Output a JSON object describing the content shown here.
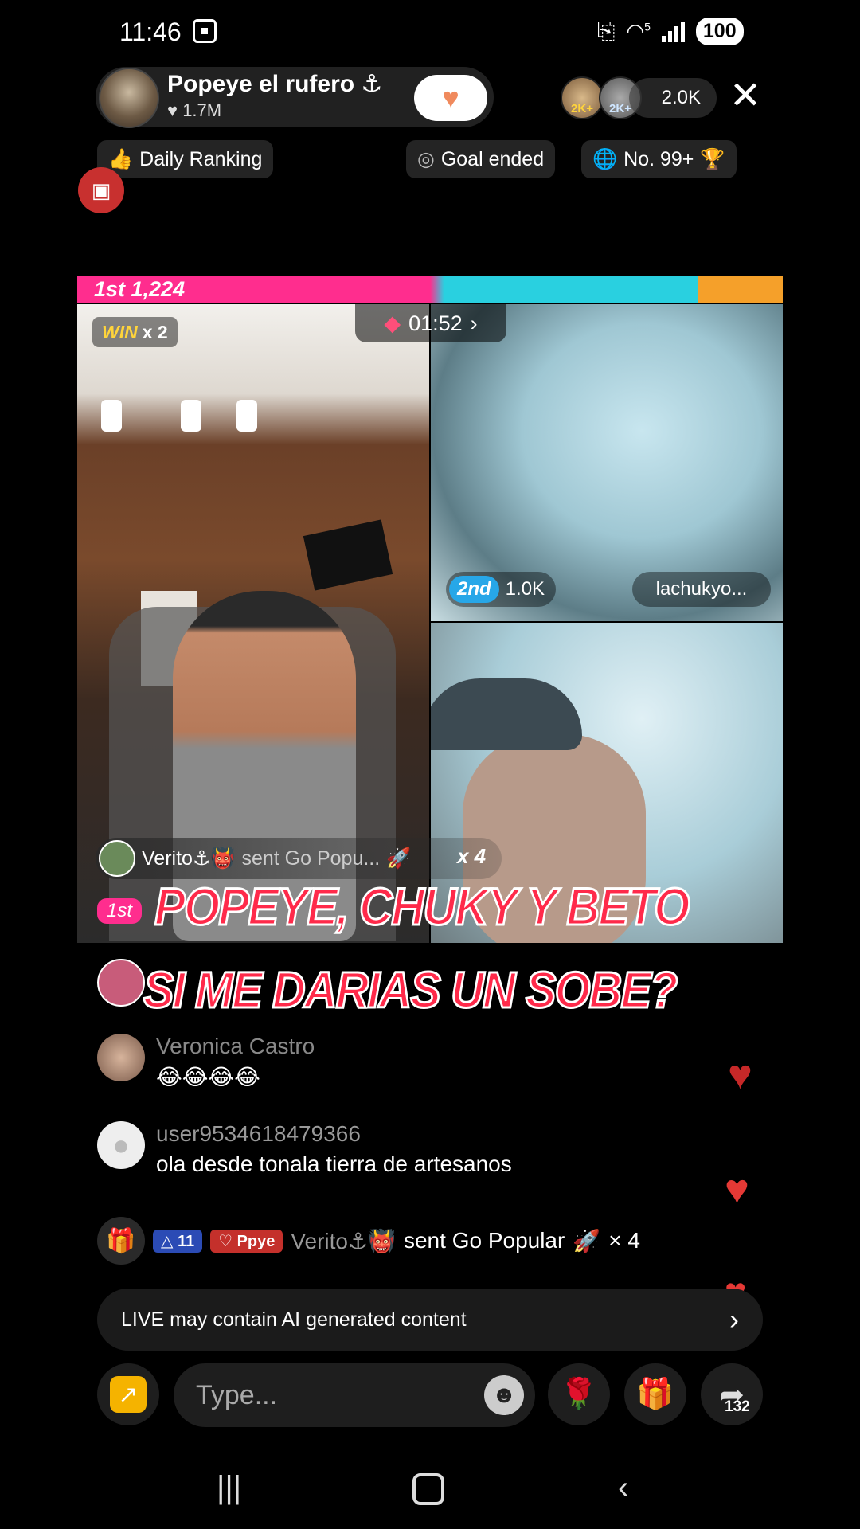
{
  "status_bar": {
    "time": "11:46",
    "signal_label": "5",
    "battery": "100"
  },
  "host": {
    "name": "Popeye el rufero ⚓",
    "likes": "1.7M",
    "follow_icon": "heart-plus-icon"
  },
  "viewers": {
    "avatar_badges": [
      "2K+",
      "2K+"
    ],
    "count": "2.0K"
  },
  "chips": {
    "daily_ranking": "Daily Ranking",
    "goal": "Goal ended",
    "rank": "No. 99+"
  },
  "battle": {
    "score_label": "1st 1,224",
    "win_label": "WIN",
    "win_count": "x 2",
    "timer": "01:52",
    "opponent_rank": "2nd",
    "opponent_score": "1.0K",
    "opponent_name": "lachukyo...",
    "first_badge": "1st",
    "gift_notice": {
      "user": "Verito⚓👹",
      "text": "sent Go Popu...",
      "count": "x 4"
    }
  },
  "overlay": {
    "line1": "POPEYE, CHUKY Y BETO",
    "line2": "SI ME DARIAS UN SOBE?"
  },
  "comments": [
    {
      "name": "Veronica Castro",
      "text": "😂😂😂😂"
    },
    {
      "name": "user9534618479366",
      "text": "ola desde tonala  tierra de  artesanos"
    }
  ],
  "gift_row": {
    "level": "11",
    "fan_badge": "Ppye",
    "user": "Verito⚓👹",
    "text": "sent Go Popular",
    "count": "× 4"
  },
  "ai_notice": "LIVE may contain AI generated content",
  "input": {
    "placeholder": "Type..."
  },
  "share_count": "132",
  "colors": {
    "accent_pink": "#ff2d8e",
    "accent_cyan": "#29d0e0",
    "heart_red": "#e53935",
    "overlay_red": "#ff2a4a"
  }
}
